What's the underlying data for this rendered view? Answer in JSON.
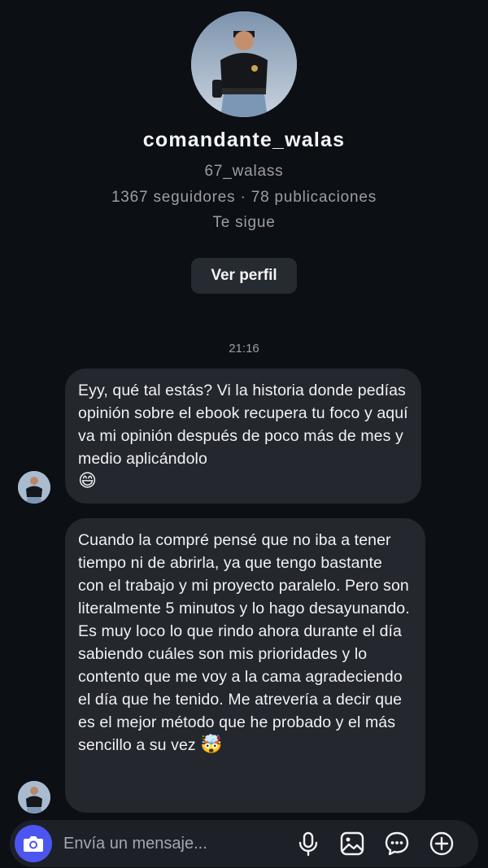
{
  "profile": {
    "username": "comandante_walas",
    "handle": "67_walass",
    "stats": "1367 seguidores · 78 publicaciones",
    "follows_you": "Te sigue",
    "view_profile_label": "Ver perfil"
  },
  "thread": {
    "timestamp": "21:16",
    "messages": [
      {
        "text": "Eyy, qué tal estás? Vi la historia donde pedías opinión sobre el ebook recupera tu foco y aquí va mi opinión después de poco más de mes y medio aplicándolo",
        "emoji": "😄"
      },
      {
        "text": "Cuando la compré pensé que no iba a tener tiempo ni de abrirla, ya que tengo bastante con el trabajo y mi proyecto paralelo. Pero son literalmente 5 minutos y lo hago desayunando. Es muy loco lo que rindo ahora durante el día sabiendo cuáles son mis prioridades y lo contento que me voy a la cama agradeciendo el día que he tenido. Me atrevería a decir que es el mejor método que he probado y el más sencillo a su vez",
        "emoji": "🤯"
      }
    ]
  },
  "composer": {
    "placeholder": "Envía un mensaje...",
    "icons": [
      "camera-icon",
      "microphone-icon",
      "gallery-icon",
      "sticker-icon",
      "add-icon"
    ]
  },
  "colors": {
    "background": "#0c0f14",
    "bubble": "#24272e",
    "accent": "#4b56f0",
    "muted_text": "#9a9ea7"
  }
}
